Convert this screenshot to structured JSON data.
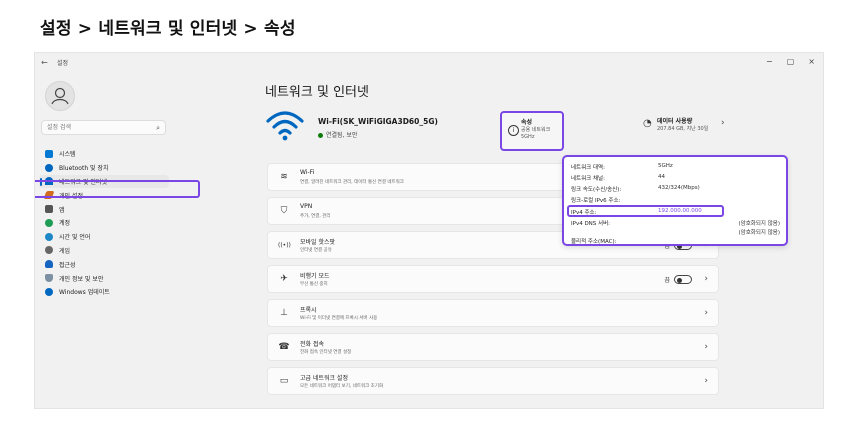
{
  "heading": "설정 > 네트워크 및 인터넷 > 속성",
  "window": {
    "back": "←",
    "title": "설정",
    "controls": [
      "−",
      "▢",
      "×"
    ]
  },
  "search": {
    "placeholder": "설정 검색",
    "icon": "search-icon"
  },
  "sidebar": {
    "items": [
      {
        "label": "시스템",
        "icon": "system-icon",
        "color": "#0078d4"
      },
      {
        "label": "Bluetooth 및 장치",
        "icon": "bluetooth-icon",
        "color": "#0067c0"
      },
      {
        "label": "네트워크 및 인터넷",
        "icon": "wifi-icon",
        "color": "#0067c0",
        "active": true
      },
      {
        "label": "개인 설정",
        "icon": "brush-icon",
        "color": "#d06b1f"
      },
      {
        "label": "앱",
        "icon": "apps-icon",
        "color": "#555555"
      },
      {
        "label": "계정",
        "icon": "account-icon",
        "color": "#1f9d55"
      },
      {
        "label": "시간 및 언어",
        "icon": "globe-icon",
        "color": "#1e88c7"
      },
      {
        "label": "게임",
        "icon": "gamepad-icon",
        "color": "#666666"
      },
      {
        "label": "접근성",
        "icon": "accessibility-icon",
        "color": "#1565c0"
      },
      {
        "label": "개인 정보 및 보안",
        "icon": "shield-icon",
        "color": "#7d8fa3"
      },
      {
        "label": "Windows 업데이트",
        "icon": "update-icon",
        "color": "#0067c0"
      }
    ]
  },
  "page_title": "네트워크 및 인터넷",
  "connection": {
    "ssid": "Wi-Fi(SK_WiFiGIGA3D60_5G)",
    "status": "연결됨, 보안",
    "status_color": "#0f7b0f"
  },
  "properties": {
    "title": "속성",
    "line1": "공용 네트워크",
    "line2": "5GHz"
  },
  "data_usage": {
    "title": "데이터 사용량",
    "detail": "207.84 GB, 지난 30일"
  },
  "rows": [
    {
      "title": "Wi-Fi",
      "sub": "연결, 알려진 네트워크 관리, 데이터 통신 연결 네트워크",
      "icon": "wifi-icon",
      "glyph": "≋"
    },
    {
      "title": "VPN",
      "sub": "추가, 연결, 관리",
      "icon": "vpn-shield-icon",
      "glyph": "⛉"
    },
    {
      "title": "모바일 핫스팟",
      "sub": "인터넷 연결 공유",
      "icon": "hotspot-icon",
      "glyph": "((•))",
      "toggle": "끔"
    },
    {
      "title": "비행기 모드",
      "sub": "무선 통신 중지",
      "icon": "airplane-icon",
      "glyph": "✈",
      "toggle": "끔"
    },
    {
      "title": "프록시",
      "sub": "Wi-Fi 및 이더넷 연결에 프록시 서버 사용",
      "icon": "proxy-icon",
      "glyph": "⊥"
    },
    {
      "title": "전화 접속",
      "sub": "전화 접속 인터넷 연결 설정",
      "icon": "dialup-icon",
      "glyph": "☎"
    },
    {
      "title": "고급 네트워크 설정",
      "sub": "모든 네트워크 어댑터 보기, 네트워크 초기화",
      "icon": "monitor-icon",
      "glyph": "▭"
    }
  ],
  "popup": {
    "band_label": "네트워크 대역:",
    "band_value": "5GHz",
    "channel_label": "네트워크 채널:",
    "channel_value": "44",
    "speed_label": "링크 속도(수신/송신):",
    "speed_value": "432/324(Mbps)",
    "ipv6_label": "링크-로컬 IPv6 주소:",
    "ipv4_label": "IPv4 주소:",
    "ipv4_value": "192.000.00.000",
    "dns_label": "IPv4 DNS 서버:",
    "dns_value1": "(암호화되지 않음)",
    "dns_value2": "(암호화되지 않음)",
    "mac_label": "물리적 주소(MAC):"
  },
  "accent_color": "#7a47e6"
}
